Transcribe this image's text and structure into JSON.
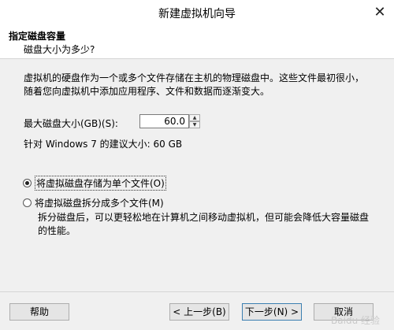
{
  "window": {
    "title": "新建虚拟机向导"
  },
  "header": {
    "title": "指定磁盘容量",
    "subtitle": "磁盘大小为多少?"
  },
  "body": {
    "description": "虚拟机的硬盘作为一个或多个文件存储在主机的物理磁盘中。这些文件最初很小，随着您向虚拟机中添加应用程序、文件和数据而逐渐变大。",
    "size_label": "最大磁盘大小(GB)(S):",
    "size_value": "60.0",
    "recommended": "针对 Windows 7 的建议大小: 60 GB",
    "option_single": "将虚拟磁盘存储为单个文件(O)",
    "option_multi": "将虚拟磁盘拆分成多个文件(M)",
    "multi_description": "拆分磁盘后，可以更轻松地在计算机之间移动虚拟机，但可能会降低大容量磁盘的性能。",
    "selected_option": "single"
  },
  "footer": {
    "help": "帮助",
    "back": "< 上一步(B)",
    "next": "下一步(N) >",
    "cancel": "取消"
  },
  "watermark": "Baidu 经验"
}
